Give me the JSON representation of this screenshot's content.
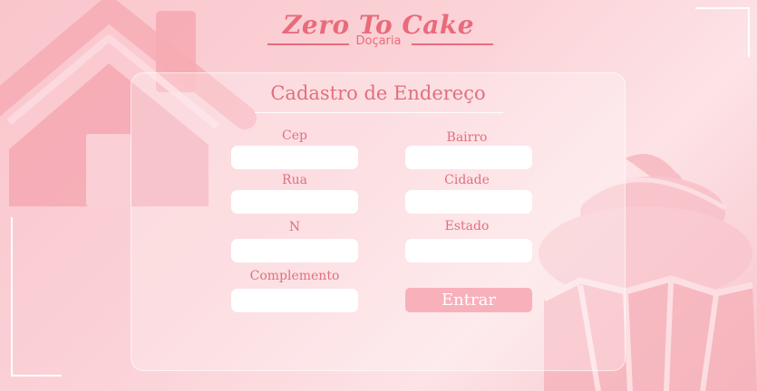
{
  "brand": {
    "title": "Zero To Cake",
    "subtitle": "Doçaria"
  },
  "form": {
    "title": "Cadastro de Endereço",
    "fields": {
      "cep": {
        "label": "Cep",
        "value": ""
      },
      "rua": {
        "label": "Rua",
        "value": ""
      },
      "numero": {
        "label": "N",
        "value": ""
      },
      "complemento": {
        "label": "Complemento",
        "value": ""
      },
      "bairro": {
        "label": "Bairro",
        "value": ""
      },
      "cidade": {
        "label": "Cidade",
        "value": ""
      },
      "estado": {
        "label": "Estado",
        "value": ""
      }
    },
    "submit_label": "Entrar"
  },
  "colors": {
    "accent": "#e96b7b",
    "background": "#fbd3d8",
    "button": "#f8b0bb",
    "input": "#ffffff"
  },
  "decorations": [
    "house-illustration",
    "cupcake-illustration"
  ]
}
